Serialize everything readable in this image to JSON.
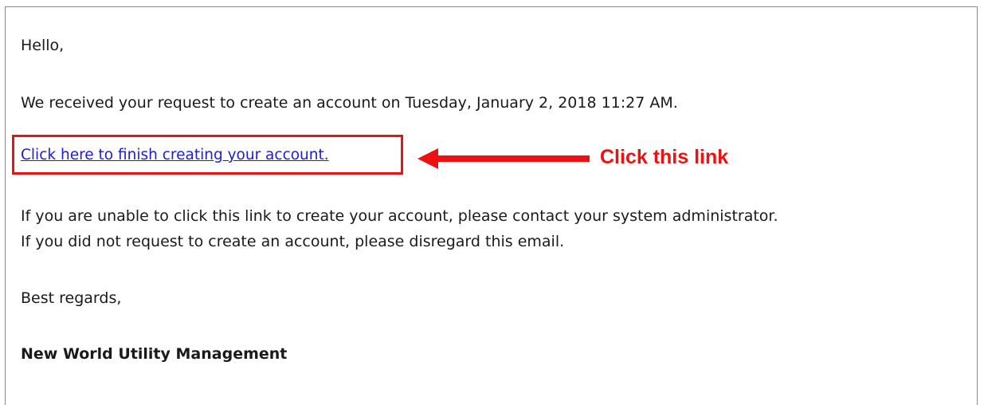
{
  "email": {
    "greeting": "Hello,",
    "received": "We received your request to create an account on Tuesday, January 2, 2018 11:27 AM.",
    "link_text": "Click here to finish creating your account.",
    "unable_line": "If you are unable to click this link to create your account, please contact your system administrator.",
    "disregard_line": "If you did not request to create an account, please disregard this email.",
    "closing": "Best regards,",
    "signature": "New World Utility Management"
  },
  "annotation": {
    "callout_text": "Click this link",
    "highlight_color": "#ee1111",
    "arrow_icon": "left-arrow-icon"
  },
  "colors": {
    "link": "#1d1dd6",
    "text": "#1a1a1a",
    "annotation": "#ee1111"
  }
}
